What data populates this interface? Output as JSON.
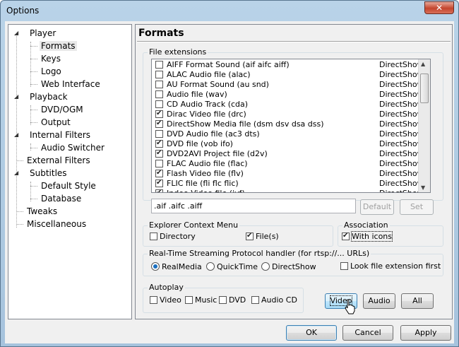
{
  "window": {
    "title": "Options",
    "close_glyph": "✕"
  },
  "tree": {
    "items": [
      {
        "label": "Player",
        "expanded": true
      },
      {
        "label": "Formats",
        "selected": true
      },
      {
        "label": "Keys"
      },
      {
        "label": "Logo"
      },
      {
        "label": "Web Interface"
      },
      {
        "label": "Playback",
        "expanded": true
      },
      {
        "label": "DVD/OGM"
      },
      {
        "label": "Output"
      },
      {
        "label": "Internal Filters",
        "expanded": true
      },
      {
        "label": "Audio Switcher"
      },
      {
        "label": "External Filters"
      },
      {
        "label": "Subtitles",
        "expanded": true
      },
      {
        "label": "Default Style"
      },
      {
        "label": "Database"
      },
      {
        "label": "Tweaks"
      },
      {
        "label": "Miscellaneous"
      }
    ]
  },
  "formats": {
    "title": "Formats",
    "file_extensions_label": "File extensions",
    "list": [
      {
        "name": "AIFF Format Sound (aif aifc aiff)",
        "filter": "DirectShow",
        "checked": false
      },
      {
        "name": "ALAC Audio file (alac)",
        "filter": "DirectShow",
        "checked": false
      },
      {
        "name": "AU Format Sound (au snd)",
        "filter": "DirectShow",
        "checked": false
      },
      {
        "name": "Audio file (wav)",
        "filter": "DirectShow",
        "checked": false
      },
      {
        "name": "CD Audio Track (cda)",
        "filter": "DirectShow",
        "checked": false
      },
      {
        "name": "Dirac Video file (drc)",
        "filter": "DirectShow",
        "checked": true
      },
      {
        "name": "DirectShow Media file (dsm dsv dsa dss)",
        "filter": "DirectShow",
        "checked": true
      },
      {
        "name": "DVD Audio file (ac3 dts)",
        "filter": "DirectShow",
        "checked": false
      },
      {
        "name": "DVD file (vob ifo)",
        "filter": "DirectShow",
        "checked": true
      },
      {
        "name": "DVD2AVI Project file (d2v)",
        "filter": "DirectShow",
        "checked": true
      },
      {
        "name": "FLAC Audio file (flac)",
        "filter": "DirectShow",
        "checked": false
      },
      {
        "name": "Flash Video file (flv)",
        "filter": "DirectShow",
        "checked": true
      },
      {
        "name": "FLIC file (fli flc flic)",
        "filter": "DirectShow",
        "checked": true
      },
      {
        "name": "Indeo Video file (ivf)",
        "filter": "DirectShow",
        "checked": true
      }
    ],
    "extensions_value": ".aif .aifc .aiff",
    "default_button": "Default",
    "set_button": "Set",
    "context_menu": {
      "label": "Explorer Context Menu",
      "directory": "Directory",
      "directory_checked": false,
      "files": "File(s)",
      "files_checked": true
    },
    "association": {
      "label": "Association",
      "with_icons": "With icons",
      "with_icons_checked": true
    },
    "rtsp": {
      "label": "Real-Time Streaming Protocol handler (for rtsp://... URLs)",
      "options": [
        "RealMedia",
        "QuickTime",
        "DirectShow"
      ],
      "selected": "RealMedia",
      "look_ext": "Look file extension first",
      "look_ext_checked": false
    },
    "autoplay": {
      "label": "Autoplay",
      "video": "Video",
      "music": "Music",
      "dvd": "DVD",
      "audio_cd": "Audio CD"
    },
    "quick_buttons": {
      "video": "Video",
      "audio": "Audio",
      "all": "All"
    }
  },
  "dialog_buttons": {
    "ok": "OK",
    "cancel": "Cancel",
    "apply": "Apply"
  }
}
